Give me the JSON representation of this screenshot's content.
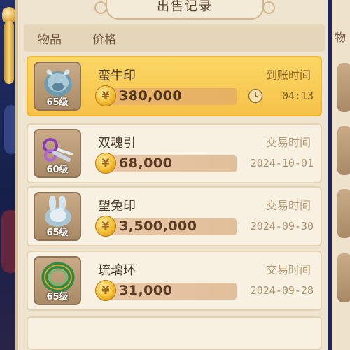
{
  "title": "出售记录",
  "headers": {
    "item": "物品",
    "price": "价格"
  },
  "right_header": "物",
  "rows": [
    {
      "name": "蛮牛印",
      "level": "65级",
      "price": "380,000",
      "time_label": "到账时间",
      "time": "04:13",
      "icon": "bull-seal-icon"
    },
    {
      "name": "双魂引",
      "level": "60级",
      "price": "68,000",
      "time_label": "交易时间",
      "time": "2024-10-01",
      "icon": "purple-chain-icon"
    },
    {
      "name": "望兔印",
      "level": "65级",
      "price": "3,500,000",
      "time_label": "交易时间",
      "time": "2024-09-30",
      "icon": "rabbit-seal-icon"
    },
    {
      "name": "琉璃环",
      "level": "65级",
      "price": "31,000",
      "time_label": "交易时间",
      "time": "2024-09-28",
      "icon": "jade-ring-icon"
    }
  ],
  "colors": {
    "selected_bg": "#f6c24a",
    "panel_bg": "#efe4cf",
    "coin": "#f1b82a"
  }
}
